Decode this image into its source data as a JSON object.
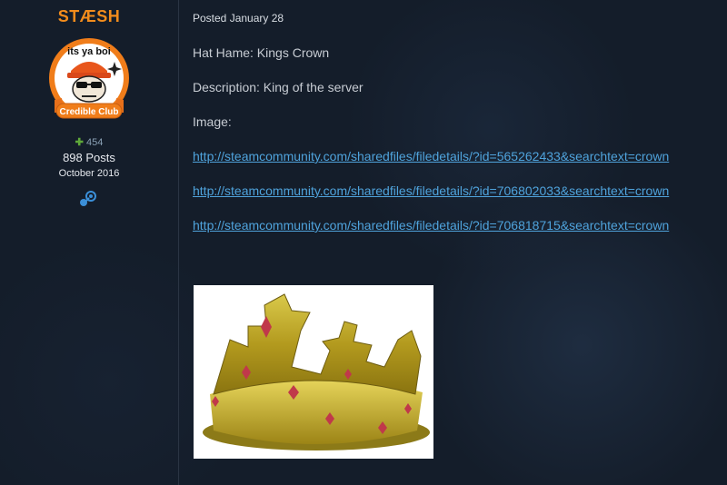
{
  "author": {
    "username": "STÆSH",
    "avatar_text_top": "its ya boi",
    "avatar_badge": "Credible Club",
    "reputation": "454",
    "posts": "898 Posts",
    "joined": "October 2016",
    "steam_icon": "steam-icon"
  },
  "post": {
    "posted": "Posted January 28",
    "hat_name": "Hat Hame: Kings Crown",
    "description": "Description: King of the server",
    "image_label": "Image:",
    "links": [
      "http://steamcommunity.com/sharedfiles/filedetails/?id=565262433&searchtext=crown",
      "http://steamcommunity.com/sharedfiles/filedetails/?id=706802033&searchtext=crown",
      "http://steamcommunity.com/sharedfiles/filedetails/?id=706818715&searchtext=crown"
    ]
  },
  "colors": {
    "accent": "#f28c1c",
    "link": "#4fa3dc",
    "reputation": "#5fa93a"
  }
}
